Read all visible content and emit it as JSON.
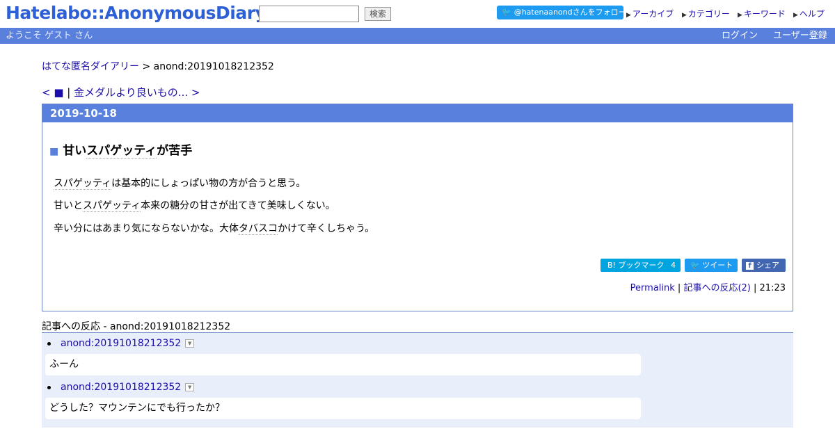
{
  "header": {
    "logo": "Hatelabo::AnonymousDiary",
    "search": {
      "value": "",
      "button_label": "検索"
    },
    "follow_label": "@hatenaanondさんをフォロー",
    "nav": [
      "アーカイブ",
      "カテゴリー",
      "キーワード",
      "ヘルプ"
    ]
  },
  "bar": {
    "welcome": "ようこそ ゲスト さん",
    "login": "ログイン",
    "register": "ユーザー登録"
  },
  "breadcrumb": {
    "home": "はてな匿名ダイアリー",
    "separator": " > ",
    "current": "anond:20191018212352"
  },
  "pager": {
    "prev": "< ■",
    "separator": " | ",
    "next": "金メダルより良いもの... >"
  },
  "entry": {
    "date": "2019-10-18",
    "title_mark": "■",
    "title_pre": "甘い",
    "title_kw": "スパゲッティ",
    "title_post": "が苦手",
    "p1_kw": "スパゲッティ",
    "p1_post": "は基本的にしょっぱい物の方が合うと思う。",
    "p2_pre": "甘いと",
    "p2_kw": "スパゲッティ",
    "p2_post": "本来の糖分の甘さが出てきて美味しくない。",
    "p3_pre": "辛い分にはあまり気にならないかな。大体",
    "p3_kw": "タバスコ",
    "p3_post": "かけて辛くしちゃう。",
    "share": {
      "bookmark_label": "B! ブックマーク",
      "bookmark_count": "4",
      "tweet_label": "ツイート",
      "share_label": "シェア"
    },
    "meta": {
      "permalink": "Permalink",
      "separator": " | ",
      "reactions": "記事への反応(2)",
      "time": "21:23"
    }
  },
  "reactions": {
    "title": "記事への反応 - anond:20191018212352",
    "items": [
      {
        "link": "anond:20191018212352",
        "body": "ふーん"
      },
      {
        "link": "anond:20191018212352",
        "body": "どうした？マウンテンにでも行ったか？"
      }
    ]
  }
}
